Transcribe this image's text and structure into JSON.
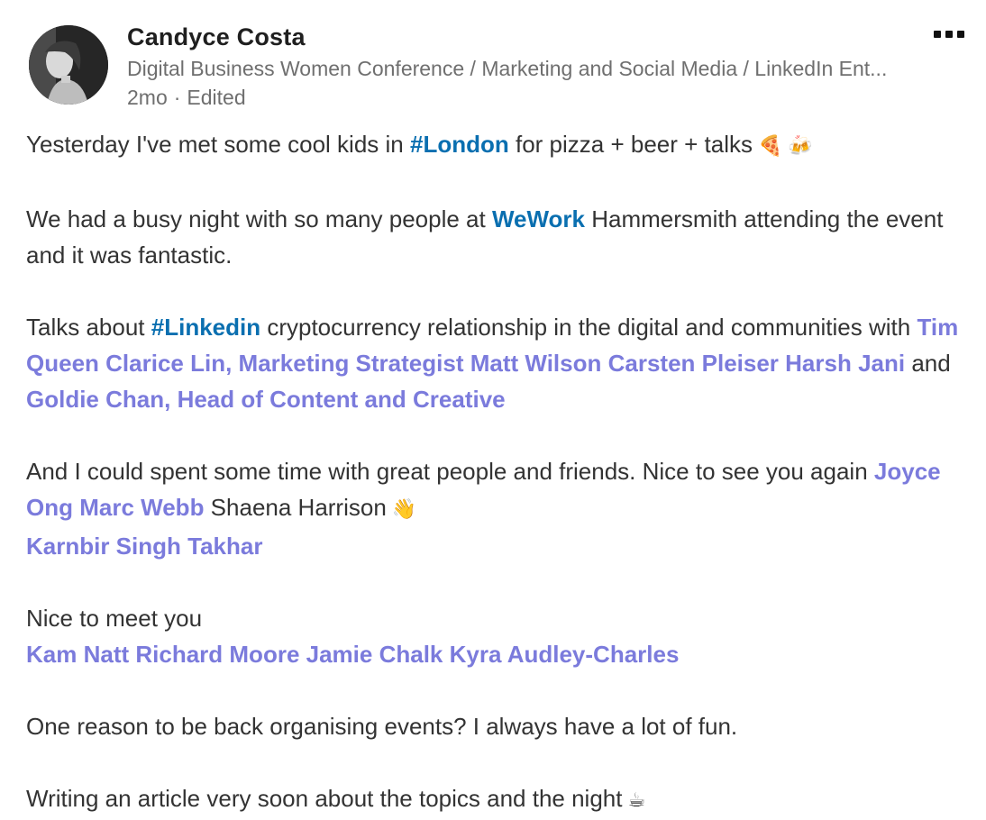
{
  "author": {
    "name": "Candyce Costa",
    "headline": "Digital Business Women Conference / Marketing and Social Media / LinkedIn Ent...",
    "time": "2mo",
    "separator": "·",
    "edited": "Edited"
  },
  "post": {
    "p1": {
      "t1": "Yesterday I've met some cool kids in ",
      "hashtag_london": "#London",
      "t2": " for pizza + beer + talks",
      "emoji1": "🍕",
      "emoji2": "🍻"
    },
    "p2": {
      "t1": "We had a busy night with so many people at ",
      "company_wework": "WeWork",
      "t2": " Hammersmith attending the event and it was fantastic."
    },
    "p3": {
      "t1": "Talks about ",
      "hashtag_linkedin": "#Linkedin",
      "t2": " cryptocurrency relationship in the digital and communities with ",
      "mention_tim": "Tim Queen",
      "mention_clarice": "Clarice Lin, Marketing Strategist",
      "mention_matt": "Matt Wilson",
      "mention_carsten": "Carsten Pleiser",
      "mention_harsh": "Harsh Jani",
      "and": " and ",
      "mention_goldie": "Goldie Chan, Head of Content and Creative"
    },
    "p4": {
      "t1": "And I could spent some time with great people and friends. Nice to see you again ",
      "mention_joyce": "Joyce Ong",
      "mention_marc": "Marc Webb",
      "t2": " Shaena Harrison",
      "emoji_wave": "👋",
      "mention_karnbir": "Karnbir Singh Takhar"
    },
    "p5": {
      "t1": "Nice to meet you",
      "mention_kam": "Kam Natt",
      "mention_richard": "Richard Moore",
      "mention_jamie": "Jamie Chalk",
      "mention_kyra": "Kyra Audley-Charles"
    },
    "p6": {
      "t1": "One reason to be back organising events? I always have a lot of fun."
    },
    "p7": {
      "t1": "Writing an article very soon about the topics and the night",
      "emoji_coffee": "☕"
    }
  },
  "colors": {
    "hashtag": "#0a6fb0",
    "mention": "#7b7bdc",
    "text": "#333333",
    "meta": "#6f6f6f"
  },
  "icons": {
    "more": "more-horizontal-icon"
  }
}
